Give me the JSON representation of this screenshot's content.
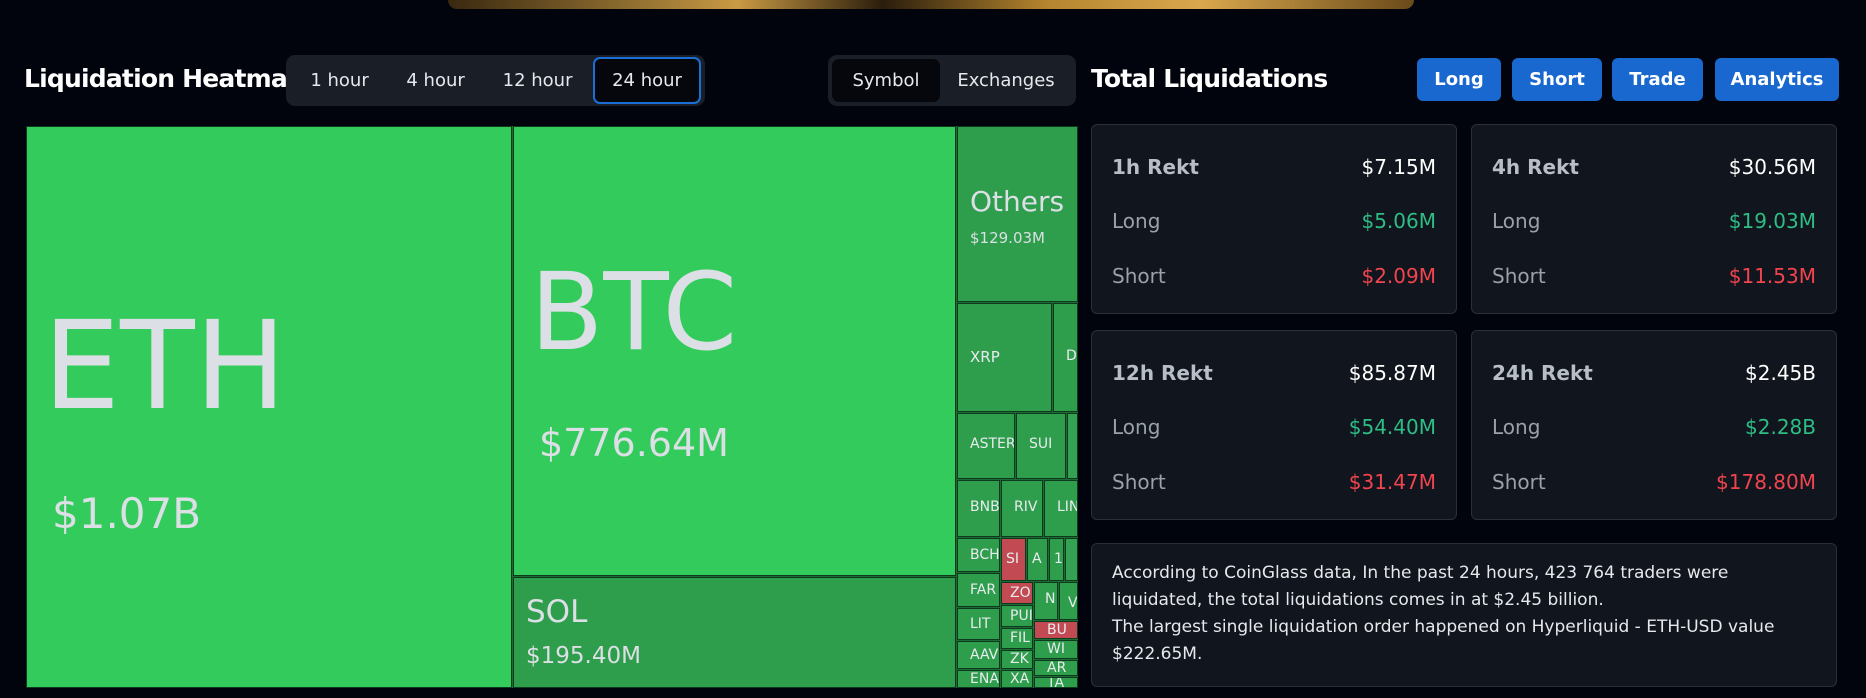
{
  "heatmap": {
    "title": "Liquidation Heatmap",
    "time_ranges": [
      "1 hour",
      "4 hour",
      "12 hour",
      "24 hour"
    ],
    "active_time_range": "24 hour",
    "views": [
      "Symbol",
      "Exchanges"
    ],
    "active_view": "Symbol",
    "tiles": {
      "eth": {
        "symbol": "ETH",
        "value": "$1.07B"
      },
      "btc": {
        "symbol": "BTC",
        "value": "$776.64M"
      },
      "sol": {
        "symbol": "SOL",
        "value": "$195.40M"
      },
      "others": {
        "symbol": "Others",
        "value": "$129.03M"
      },
      "small": [
        "XRP",
        "D",
        "ASTER",
        "SUI",
        "BNB",
        "RIV",
        "LIN",
        "BCH",
        "SI",
        "A",
        "1",
        "FAR",
        "ZOR",
        "N",
        "V",
        "PUI",
        "LIT",
        "FIL",
        "BU",
        "AAV",
        "WI",
        "ZK",
        "AR",
        "ENA",
        "XA",
        "TA"
      ]
    }
  },
  "totals": {
    "title": "Total Liquidations",
    "buttons": [
      "Long",
      "Short",
      "Trade",
      "Analytics"
    ],
    "cards": [
      {
        "label": "1h Rekt",
        "total": "$7.15M",
        "long_label": "Long",
        "long": "$5.06M",
        "short_label": "Short",
        "short": "$2.09M"
      },
      {
        "label": "4h Rekt",
        "total": "$30.56M",
        "long_label": "Long",
        "long": "$19.03M",
        "short_label": "Short",
        "short": "$11.53M"
      },
      {
        "label": "12h Rekt",
        "total": "$85.87M",
        "long_label": "Long",
        "long": "$54.40M",
        "short_label": "Short",
        "short": "$31.47M"
      },
      {
        "label": "24h Rekt",
        "total": "$2.45B",
        "long_label": "Long",
        "long": "$2.28B",
        "short_label": "Short",
        "short": "$178.80M"
      }
    ],
    "summary_line1": "According to CoinGlass data, In the past 24 hours, 423 764 traders were liquidated, the total liquidations comes in at $2.45 billion.",
    "summary_line2": "The largest single liquidation order happened on Hyperliquid - ETH-USD value $222.65M."
  },
  "colors": {
    "long_green": "#2ebd85",
    "short_red": "#f0444f",
    "accent_blue": "#1868cf",
    "tile_green": "#33cc5c",
    "tile_dark_green": "#2e9e4c",
    "tile_red": "#c24a52"
  }
}
